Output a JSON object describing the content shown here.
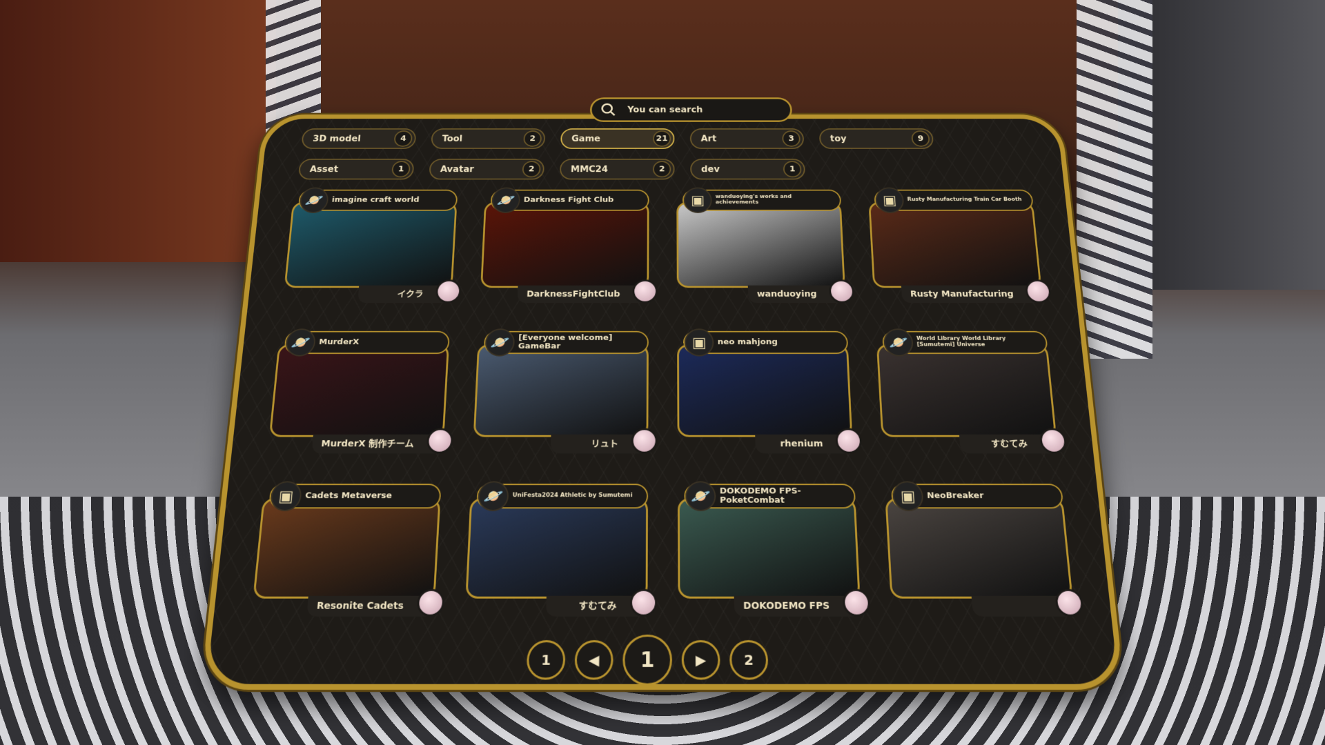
{
  "search": {
    "placeholder": "You can search",
    "icon": "search-icon"
  },
  "tags": [
    [
      {
        "label": "3D model",
        "count": "4"
      },
      {
        "label": "Tool",
        "count": "2"
      },
      {
        "label": "Game",
        "count": "21",
        "active": true
      },
      {
        "label": "Art",
        "count": "3"
      },
      {
        "label": "toy",
        "count": "9"
      }
    ],
    [
      {
        "label": "Asset",
        "count": "1"
      },
      {
        "label": "Avatar",
        "count": "2"
      },
      {
        "label": "MMC24",
        "count": "2"
      },
      {
        "label": "dev",
        "count": "1"
      }
    ]
  ],
  "cards": [
    {
      "title": "imagine craft world",
      "author": "イクラ",
      "icon": "planet-icon",
      "thumb": "#1e5a6a"
    },
    {
      "title": "Darkness Fight Club",
      "author": "DarknessFightClub",
      "icon": "planet-icon",
      "thumb": "#5a1408"
    },
    {
      "title": "wanduoying's works and achievements",
      "author": "wanduoying",
      "icon": "box-icon",
      "thumb": "#c8c8c8"
    },
    {
      "title": "Rusty Manufacturing Train Car Booth",
      "author": "Rusty Manufacturing",
      "icon": "box-icon",
      "thumb": "#5a2a18"
    },
    {
      "title": "MurderX",
      "author": "MurderX 制作チーム",
      "icon": "planet-icon",
      "thumb": "#3a1418"
    },
    {
      "title": "[Everyone welcome] GameBar",
      "author": "リュト",
      "icon": "planet-icon",
      "thumb": "#4a5a70"
    },
    {
      "title": "neo mahjong",
      "author": "rhenium",
      "icon": "box-icon",
      "thumb": "#1c2a5a"
    },
    {
      "title": "World Library World Library [Sumutemi] Universe",
      "author": "すむてみ",
      "icon": "planet-icon",
      "thumb": "#3a3230"
    },
    {
      "title": "Cadets Metaverse",
      "author": "Resonite Cadets",
      "icon": "box-icon",
      "thumb": "#6a3a1c"
    },
    {
      "title": "UniFesta2024 Athletic by Sumutemi",
      "author": "すむてみ",
      "icon": "planet-icon",
      "thumb": "#2a3a5a"
    },
    {
      "title": "DOKODEMO FPS-PoketCombat",
      "author": "DOKODEMO FPS",
      "icon": "planet-icon",
      "thumb": "#3a5a50"
    },
    {
      "title": "NeoBreaker",
      "author": "",
      "icon": "box-icon",
      "thumb": "#4a4440"
    }
  ],
  "pager": {
    "first": "1",
    "prev_icon": "triangle-left-icon",
    "current": "1",
    "next_icon": "triangle-right-icon",
    "last": "2"
  },
  "colors": {
    "accent": "#b8932e",
    "panel": "#1e1b17",
    "text": "#f2e6c4"
  }
}
